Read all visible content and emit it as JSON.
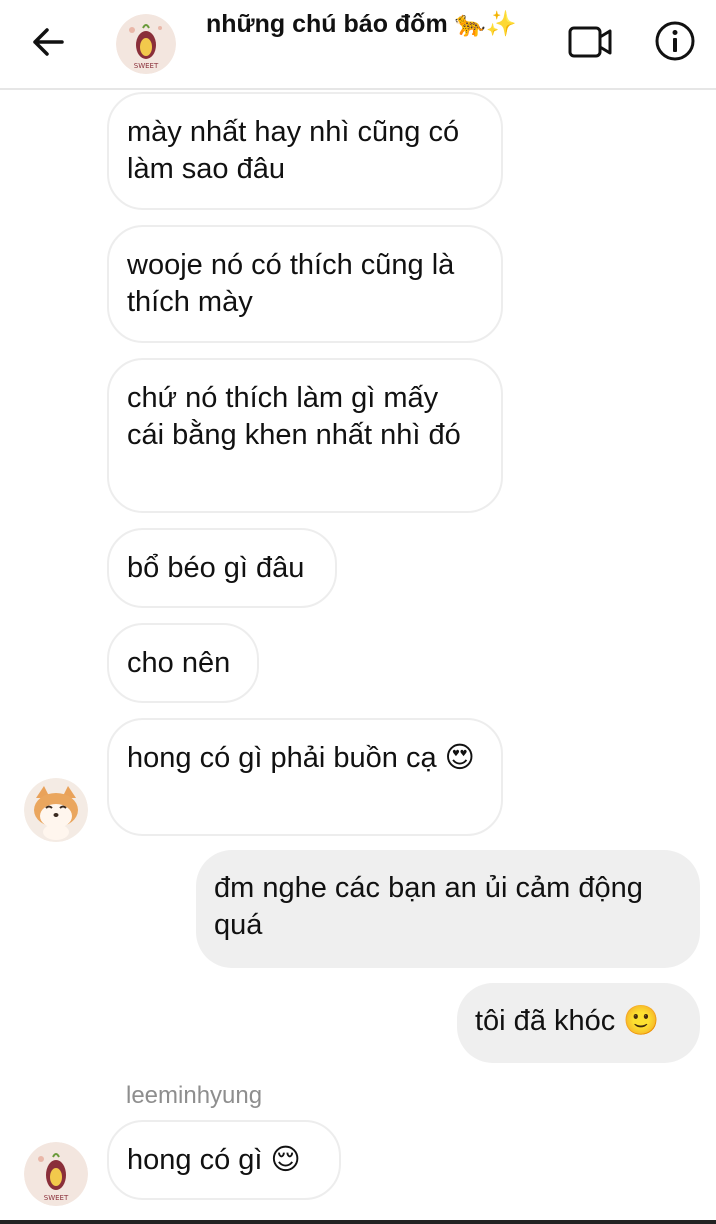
{
  "header": {
    "title": "những chú báo đốm 🐆✨",
    "back_icon": "arrow-left-icon",
    "video_icon": "video-call-icon",
    "info_icon": "info-icon"
  },
  "messages": [
    {
      "direction": "incoming",
      "text": "mày nhất hay nhì cũng có làm sao đâu"
    },
    {
      "direction": "incoming",
      "text": "wooje nó có thích cũng là thích mày"
    },
    {
      "direction": "incoming",
      "text": "chứ nó thích làm gì mấy cái bằng khen nhất nhì đó"
    },
    {
      "direction": "incoming",
      "text": "bổ béo gì đâu"
    },
    {
      "direction": "incoming",
      "text": "cho nên"
    },
    {
      "direction": "incoming",
      "text": "hong có gì phải buồn cạ 😍"
    },
    {
      "direction": "outgoing",
      "text": "đm nghe các bạn an ủi cảm động quá"
    },
    {
      "direction": "outgoing",
      "text": "tôi đã khóc 🙂"
    },
    {
      "direction": "incoming",
      "sender": "leeminhyung",
      "text": "hong có gì 😌"
    }
  ],
  "colors": {
    "incoming_border": "#ededed",
    "outgoing_bg": "#efefef",
    "sender_name": "#8e8e8e"
  },
  "avatars": {
    "group_avatar": "sweet-potato-icon",
    "sender_avatar_1": "shiba-dog-icon",
    "sender_avatar_2": "sweet-potato-icon",
    "avatar_label": "SWEET"
  }
}
